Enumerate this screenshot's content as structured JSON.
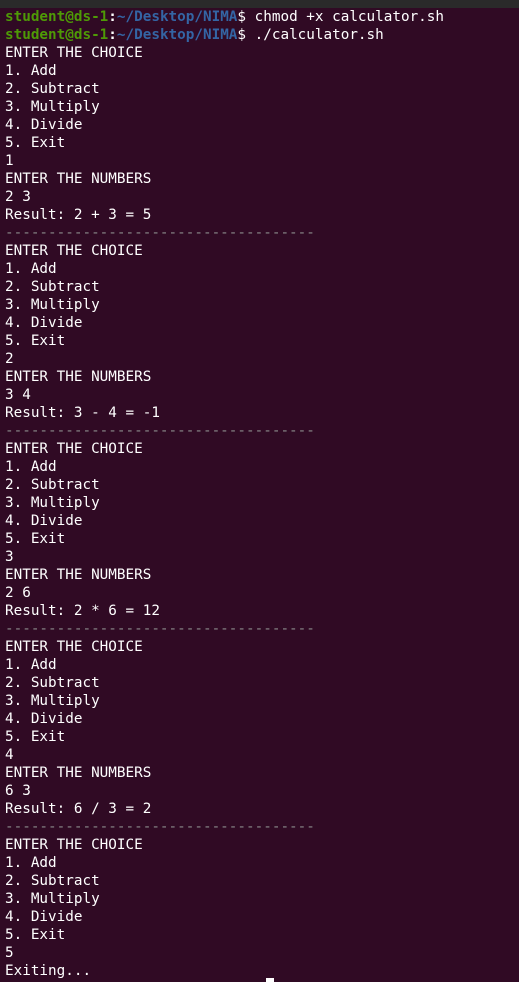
{
  "theme": {
    "background": "#300a24",
    "foreground": "#ffffff",
    "prompt_user_color": "#4e9a06",
    "prompt_path_color": "#3465a4",
    "separator_color": "#8a8a8a"
  },
  "prompts": [
    {
      "user_host": "student@ds-1",
      "colon": ":",
      "path": "~/Desktop/NIMA",
      "symbol": "$",
      "command": " chmod +x calculator.sh"
    },
    {
      "user_host": "student@ds-1",
      "colon": ":",
      "path": "~/Desktop/NIMA",
      "symbol": "$",
      "command": " ./calculator.sh"
    }
  ],
  "output_lines": [
    "ENTER THE CHOICE",
    "1. Add",
    "2. Subtract",
    "3. Multiply",
    "4. Divide",
    "5. Exit",
    "1",
    "ENTER THE NUMBERS",
    "2 3",
    "Result: 2 + 3 = 5",
    "------------------------------------",
    "ENTER THE CHOICE",
    "1. Add",
    "2. Subtract",
    "3. Multiply",
    "4. Divide",
    "5. Exit",
    "2",
    "ENTER THE NUMBERS",
    "3 4",
    "Result: 3 - 4 = -1",
    "------------------------------------",
    "ENTER THE CHOICE",
    "1. Add",
    "2. Subtract",
    "3. Multiply",
    "4. Divide",
    "5. Exit",
    "3",
    "ENTER THE NUMBERS",
    "2 6",
    "Result: 2 * 6 = 12",
    "------------------------------------",
    "ENTER THE CHOICE",
    "1. Add",
    "2. Subtract",
    "3. Multiply",
    "4. Divide",
    "5. Exit",
    "4",
    "ENTER THE NUMBERS",
    "6 3",
    "Result: 6 / 3 = 2",
    "------------------------------------",
    "ENTER THE CHOICE",
    "1. Add",
    "2. Subtract",
    "3. Multiply",
    "4. Divide",
    "5. Exit",
    "5",
    "Exiting..."
  ]
}
